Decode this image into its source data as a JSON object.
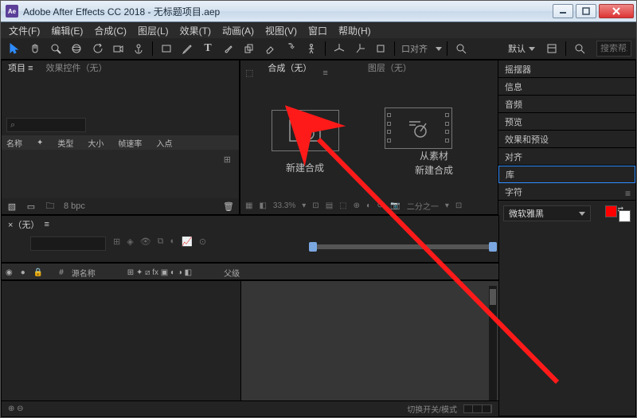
{
  "window": {
    "app_badge": "Ae",
    "title": "Adobe After Effects CC 2018 - 无标题项目.aep"
  },
  "menu": [
    "文件(F)",
    "编辑(E)",
    "合成(C)",
    "图层(L)",
    "效果(T)",
    "动画(A)",
    "视图(V)",
    "窗口",
    "帮助(H)"
  ],
  "toolbar": {
    "snap_label": "口对齐",
    "mode_label": "默认",
    "search_placeholder": "搜索帮助"
  },
  "project": {
    "tab_project": "项目",
    "tab_effects": "效果控件（无）",
    "menu_glyph": "≡",
    "search_icon": "⌕",
    "columns": {
      "name": "名称",
      "tag": "✦",
      "type": "类型",
      "size": "大小",
      "rate": "帧速率",
      "inpoint": "入点"
    },
    "footer_bpc": "8 bpc"
  },
  "viewer": {
    "lock_icon": "⬚",
    "tab_comp": "合成（无）",
    "tab_layer": "图层（无）",
    "menu_glyph": "≡",
    "card_left": "新建合成",
    "card_right_l1": "从素材",
    "card_right_l2": "新建合成",
    "footer_zoom": "33.3%",
    "footer_res": "二分之一"
  },
  "side": {
    "wiggle": "摇摆器",
    "info": "信息",
    "audio": "音频",
    "preview": "预览",
    "presets": "效果和预设",
    "align": "对齐",
    "library": "库",
    "character": "字符",
    "font_name": "微软雅黑",
    "colors": {
      "fill": "#ff0000",
      "stroke": "#ffffff"
    },
    "menu_glyph": "≡"
  },
  "timeline": {
    "tab_none": "×（无）",
    "menu_glyph": "≡",
    "columns": {
      "eye": "◉",
      "lock": "🔒",
      "num": "#",
      "source": "源名称",
      "switches": "⊞ ✦ ⧄ fx ▣ ◐ ◑ ◧",
      "parent": "父级"
    }
  },
  "footer": {
    "toggle_label": "切换开关/模式"
  }
}
